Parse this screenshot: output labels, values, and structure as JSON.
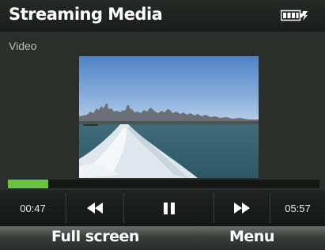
{
  "header": {
    "title": "Streaming Media",
    "status_icon": "battery-charging-icon"
  },
  "subtitle": "Video",
  "video": {
    "scene": "city-skyline-boat-wake"
  },
  "playback": {
    "progress_fraction": 0.13,
    "elapsed": "00:47",
    "total": "05:57",
    "state": "playing"
  },
  "controls": {
    "rewind_icon": "rewind-icon",
    "pause_icon": "pause-icon",
    "forward_icon": "fast-forward-icon"
  },
  "softkeys": {
    "left": "Full screen",
    "right": "Menu"
  },
  "colors": {
    "progress": "#6bc43f",
    "background": "#2b2f2c"
  }
}
